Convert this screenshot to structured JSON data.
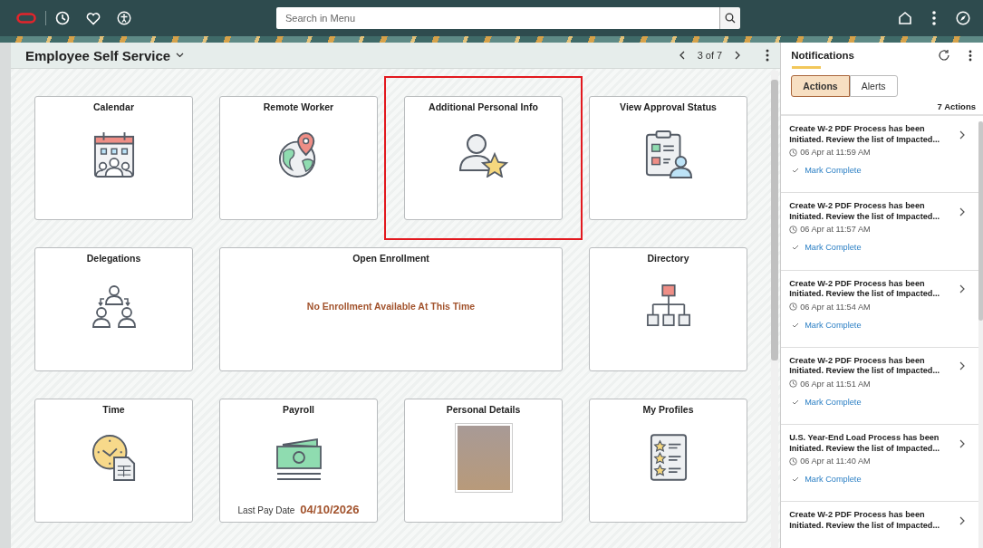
{
  "top_bar": {
    "search": {
      "placeholder": "Search in Menu"
    }
  },
  "page": {
    "title": "Employee Self Service",
    "pager": "3 of 7"
  },
  "tiles": [
    {
      "kind": "icon",
      "title": "Calendar",
      "highlighted": false
    },
    {
      "kind": "icon",
      "title": "Remote Worker",
      "highlighted": false
    },
    {
      "kind": "icon",
      "title": "Additional Personal Info",
      "highlighted": true
    },
    {
      "kind": "icon",
      "title": "View Approval Status",
      "highlighted": false
    },
    {
      "kind": "icon",
      "title": "Delegations",
      "highlighted": false
    },
    {
      "kind": "message",
      "title": "Open Enrollment",
      "message": "No Enrollment Available At This Time",
      "highlighted": false
    },
    {
      "kind": "icon",
      "title": "Directory",
      "highlighted": false
    },
    {
      "kind": "icon",
      "title": "Time",
      "highlighted": false
    },
    {
      "kind": "pay",
      "title": "Payroll",
      "label": "Last Pay Date",
      "value": "04/10/2026",
      "highlighted": false
    },
    {
      "kind": "photo",
      "title": "Personal Details",
      "highlighted": false
    },
    {
      "kind": "icon",
      "title": "My Profiles",
      "highlighted": false
    }
  ],
  "notifications": {
    "title": "Notifications",
    "tabs": [
      {
        "label": "Actions",
        "selected": true
      },
      {
        "label": "Alerts",
        "selected": false
      }
    ],
    "count": "7 Actions",
    "items": [
      {
        "title": "Create W-2 PDF Process has been Initiated. Review the list of Impacted...",
        "time": "06 Apr at 11:59 AM",
        "action": "Mark Complete"
      },
      {
        "title": "Create W-2 PDF Process has been Initiated. Review the list of Impacted...",
        "time": "06 Apr at 11:57 AM",
        "action": "Mark Complete"
      },
      {
        "title": "Create W-2 PDF Process has been Initiated. Review the list of Impacted...",
        "time": "06 Apr at 11:54 AM",
        "action": "Mark Complete"
      },
      {
        "title": "Create W-2 PDF Process has been Initiated. Review the list of Impacted...",
        "time": "06 Apr at 11:51 AM",
        "action": "Mark Complete"
      },
      {
        "title": "U.S. Year-End Load Process has been Initiated. Review the list of Impacted...",
        "time": "06 Apr at 11:40 AM",
        "action": "Mark Complete"
      },
      {
        "title": "Create W-2 PDF Process has been Initiated. Review the list of Impacted..."
      }
    ]
  }
}
